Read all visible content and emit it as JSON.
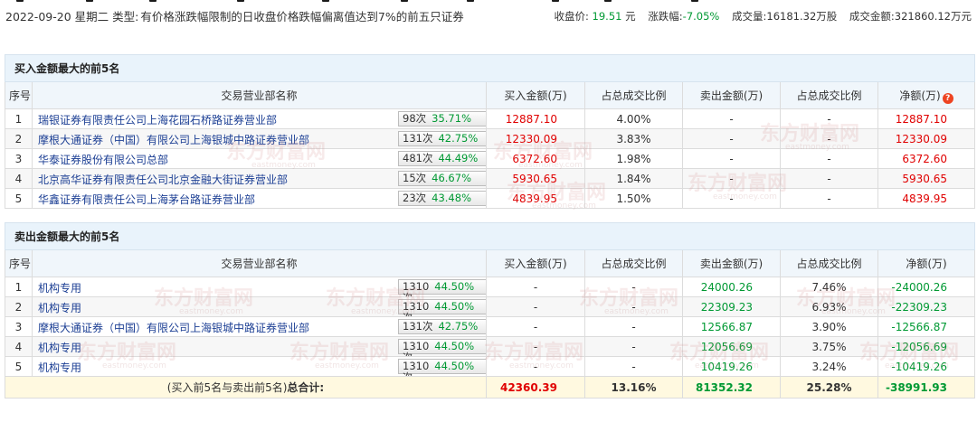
{
  "header": {
    "date": "2022-09-20",
    "weekday": "星期二",
    "type_label": "类型:",
    "type_value": "有价格涨跌幅限制的日收盘价格跌幅偏离值达到7%的前五只证券",
    "close_label": "收盘价:",
    "close_value": "19.51",
    "close_unit": "元",
    "change_label": "涨跌幅:",
    "change_value": "-7.05%",
    "volume_label": "成交量:",
    "volume_value": "16181.32万股",
    "amount_label": "成交金额:",
    "amount_value": "321860.12万元"
  },
  "columns": {
    "idx": "序号",
    "name": "交易营业部名称",
    "buy": "买入金额(万)",
    "buy_ratio": "占总成交比例",
    "sell": "卖出金额(万)",
    "sell_ratio": "占总成交比例",
    "net_buy": "净额(万)",
    "net_sell": "净额(万)"
  },
  "buy_section": {
    "title": "买入金额最大的前5名",
    "rows": [
      {
        "idx": "1",
        "name": "瑞银证券有限责任公司上海花园石桥路证券营业部",
        "count": "98次",
        "pct": "35.71%",
        "icon": "hot-icon",
        "buy": "12887.10",
        "buy_ratio": "4.00%",
        "sell": "-",
        "sell_ratio": "-",
        "net": "12887.10"
      },
      {
        "idx": "2",
        "name": "摩根大通证券（中国）有限公司上海银城中路证券营业部",
        "count": "131次",
        "pct": "42.75%",
        "icon": "arrow-icon",
        "buy": "12330.09",
        "buy_ratio": "3.83%",
        "sell": "-",
        "sell_ratio": "-",
        "net": "12330.09"
      },
      {
        "idx": "3",
        "name": "华泰证券股份有限公司总部",
        "count": "481次",
        "pct": "44.49%",
        "icon": "arrow-icon",
        "buy": "6372.60",
        "buy_ratio": "1.98%",
        "sell": "-",
        "sell_ratio": "-",
        "net": "6372.60"
      },
      {
        "idx": "4",
        "name": "北京高华证券有限责任公司北京金融大街证券营业部",
        "count": "15次",
        "pct": "46.67%",
        "icon": "arrow-icon",
        "buy": "5930.65",
        "buy_ratio": "1.84%",
        "sell": "-",
        "sell_ratio": "-",
        "net": "5930.65"
      },
      {
        "idx": "5",
        "name": "华鑫证券有限责任公司上海茅台路证券营业部",
        "count": "23次",
        "pct": "43.48%",
        "icon": "arrow-icon",
        "buy": "4839.95",
        "buy_ratio": "1.50%",
        "sell": "-",
        "sell_ratio": "-",
        "net": "4839.95"
      }
    ]
  },
  "sell_section": {
    "title": "卖出金额最大的前5名",
    "rows": [
      {
        "idx": "1",
        "name": "机构专用",
        "count": "1310",
        "count_wrap": "次",
        "pct": "44.50%",
        "icon": "hot-icon",
        "buy": "-",
        "buy_ratio": "-",
        "sell": "24000.26",
        "sell_ratio": "7.46%",
        "net": "-24000.26"
      },
      {
        "idx": "2",
        "name": "机构专用",
        "count": "1310",
        "count_wrap": "次",
        "pct": "44.50%",
        "icon": "arrow-icon",
        "buy": "-",
        "buy_ratio": "-",
        "sell": "22309.23",
        "sell_ratio": "6.93%",
        "net": "-22309.23"
      },
      {
        "idx": "3",
        "name": "摩根大通证券（中国）有限公司上海银城中路证券营业部",
        "count": "131次",
        "count_wrap": "",
        "pct": "42.75%",
        "icon": "arrow-icon",
        "buy": "-",
        "buy_ratio": "-",
        "sell": "12566.87",
        "sell_ratio": "3.90%",
        "net": "-12566.87"
      },
      {
        "idx": "4",
        "name": "机构专用",
        "count": "1310",
        "count_wrap": "次",
        "pct": "44.50%",
        "icon": "arrow-icon",
        "buy": "-",
        "buy_ratio": "-",
        "sell": "12056.69",
        "sell_ratio": "3.75%",
        "net": "-12056.69"
      },
      {
        "idx": "5",
        "name": "机构专用",
        "count": "1310",
        "count_wrap": "次",
        "pct": "44.50%",
        "icon": "arrow-icon",
        "buy": "-",
        "buy_ratio": "-",
        "sell": "10419.26",
        "sell_ratio": "3.24%",
        "net": "-10419.26"
      }
    ],
    "total": {
      "label_prefix": "(买入前5名与卖出前5名)",
      "label_bold": "总合计:",
      "buy": "42360.39",
      "buy_ratio": "13.16%",
      "sell": "81352.32",
      "sell_ratio": "25.28%",
      "net": "-38991.93"
    }
  },
  "watermark": {
    "cn": "东方财富网",
    "en": "eastmoney.com"
  },
  "colors": {
    "up": "#e00000",
    "down": "#009933",
    "link": "#1c3f94",
    "section_bg": "#e9f3fb",
    "total_bg": "#fff9e0"
  }
}
